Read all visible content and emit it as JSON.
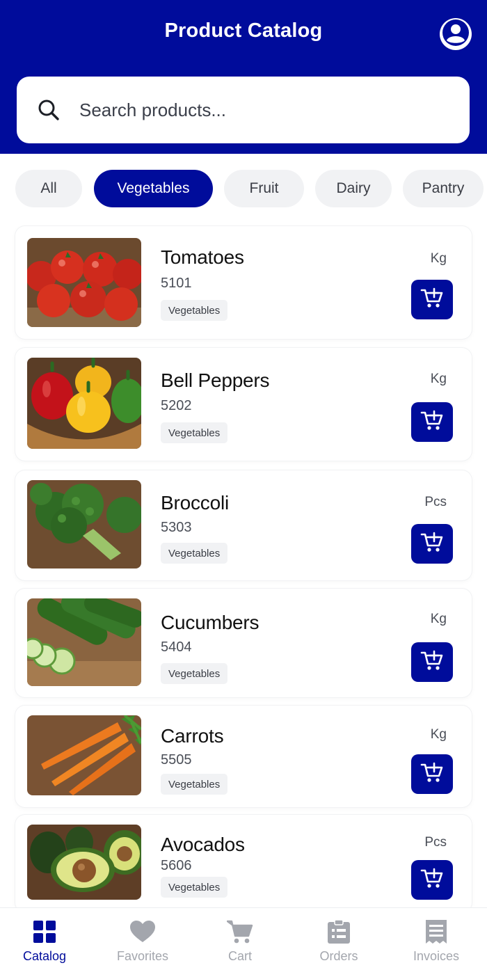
{
  "header": {
    "title": "Product Catalog",
    "profile_icon": "user-circle-icon",
    "background": "#000c9b"
  },
  "search": {
    "placeholder": "Search products...",
    "icon": "search-icon"
  },
  "categories": [
    {
      "label": "All",
      "active": false
    },
    {
      "label": "Vegetables",
      "active": true
    },
    {
      "label": "Fruit",
      "active": false
    },
    {
      "label": "Dairy",
      "active": false
    },
    {
      "label": "Pantry",
      "active": false
    }
  ],
  "products": [
    {
      "name": "Tomatoes",
      "code": "5101",
      "category": "Vegetables",
      "unit": "Kg",
      "image": "tomatoes-image"
    },
    {
      "name": "Bell Peppers",
      "code": "5202",
      "category": "Vegetables",
      "unit": "Kg",
      "image": "bell-peppers-image"
    },
    {
      "name": "Broccoli",
      "code": "5303",
      "category": "Vegetables",
      "unit": "Pcs",
      "image": "broccoli-image"
    },
    {
      "name": "Cucumbers",
      "code": "5404",
      "category": "Vegetables",
      "unit": "Kg",
      "image": "cucumbers-image"
    },
    {
      "name": "Carrots",
      "code": "5505",
      "category": "Vegetables",
      "unit": "Kg",
      "image": "carrots-image"
    },
    {
      "name": "Avocados",
      "code": "5606",
      "category": "Vegetables",
      "unit": "Pcs",
      "image": "avocados-image"
    }
  ],
  "add_button_icon": "add-to-cart-icon",
  "nav": [
    {
      "label": "Catalog",
      "icon": "grid-icon",
      "active": true
    },
    {
      "label": "Favorites",
      "icon": "heart-icon",
      "active": false
    },
    {
      "label": "Cart",
      "icon": "cart-icon",
      "active": false
    },
    {
      "label": "Orders",
      "icon": "clipboard-icon",
      "active": false
    },
    {
      "label": "Invoices",
      "icon": "receipt-icon",
      "active": false
    }
  ],
  "colors": {
    "primary": "#000c9b",
    "chip_bg": "#f1f2f4",
    "nav_inactive": "#a3a6ad"
  }
}
